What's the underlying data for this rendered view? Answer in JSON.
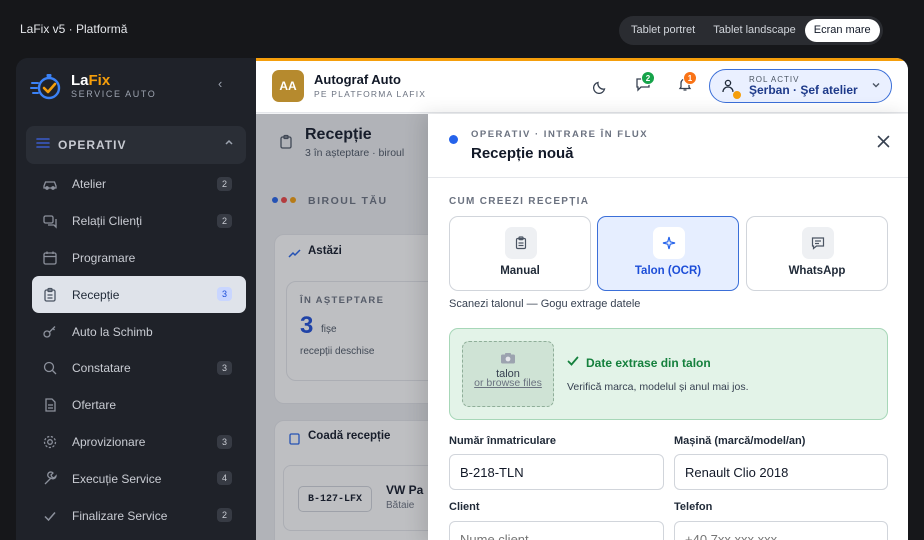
{
  "app": {
    "title": "LaFix v5 · Platformă",
    "view_modes": [
      "Tablet portret",
      "Tablet landscape",
      "Ecran mare"
    ]
  },
  "brand": {
    "name_prefix": "La",
    "name_suffix": "Fix",
    "subtitle": "SERVICE AUTO",
    "collapse_symbol": "‹"
  },
  "sidebar": {
    "group_label": "OPERATIV",
    "items": [
      {
        "label": "Atelier",
        "count": "2",
        "icon": "car-icon"
      },
      {
        "label": "Relații Clienți",
        "count": "2",
        "icon": "chat-icon"
      },
      {
        "label": "Programare",
        "count": "",
        "icon": "calendar-icon"
      },
      {
        "label": "Recepție",
        "count": "3",
        "icon": "clipboard-icon"
      },
      {
        "label": "Auto la Schimb",
        "count": "",
        "icon": "key-icon"
      },
      {
        "label": "Constatare",
        "count": "3",
        "icon": "magnifier-icon"
      },
      {
        "label": "Ofertare",
        "count": "",
        "icon": "document-icon"
      },
      {
        "label": "Aprovizionare",
        "count": "3",
        "icon": "gear-icon"
      },
      {
        "label": "Execuție Service",
        "count": "4",
        "icon": "wrench-icon"
      },
      {
        "label": "Finalizare Service",
        "count": "2",
        "icon": "check-icon"
      }
    ]
  },
  "header": {
    "org_initials": "AA",
    "org_name": "Autograf Auto",
    "org_sub": "PE PLATFORMA LAFIX",
    "messages_count": "2",
    "alerts_count": "1",
    "role_label": "ROL ACTIV",
    "role_name": "Şerban · Şef atelier"
  },
  "page": {
    "title": "Recepție",
    "subtitle": "3 în așteptare · biroul",
    "office_label": "BIROUL TĂU",
    "today_title": "Astăzi",
    "stat_label": "ÎN AȘTEPTARE",
    "stat_value": "3",
    "stat_unit": "fișe",
    "stat_desc": "recepții deschise",
    "queue_title": "Coadă recepție",
    "queue_plate": "B-127-LFX",
    "queue_car": "VW Pa",
    "queue_note": "Bătaie"
  },
  "drawer": {
    "kicker": "OPERATIV · INTRARE ÎN FLUX",
    "title": "Recepție nouă",
    "section_label": "CUM CREEZI RECEPȚIA",
    "methods": [
      {
        "label": "Manual",
        "icon": "clipboard-icon"
      },
      {
        "label": "Talon (OCR)",
        "icon": "sparkle-icon"
      },
      {
        "label": "WhatsApp",
        "icon": "message-icon"
      }
    ],
    "active_method": "Talon (OCR)",
    "method_hint": "Scanezi talonul — Gogu extrage datele",
    "upload_line1": "talon",
    "upload_line2": "or browse files",
    "ocr_status": "Date extrase din talon",
    "ocr_desc": "Verifică marca, modelul și anul mai jos.",
    "fields": {
      "plate_label": "Număr înmatriculare",
      "plate_value": "B-218-TLN",
      "car_label": "Mașină (marcă/model/an)",
      "car_value": "Renault Clio 2018",
      "client_label": "Client",
      "client_placeholder": "Nume client",
      "phone_label": "Telefon",
      "phone_placeholder": "+40 7xx xxx xxx"
    }
  },
  "colors": {
    "accent": "#f59e0b",
    "primary": "#2563eb",
    "success": "#15803d",
    "sidebar_bg": "#1f2229"
  }
}
